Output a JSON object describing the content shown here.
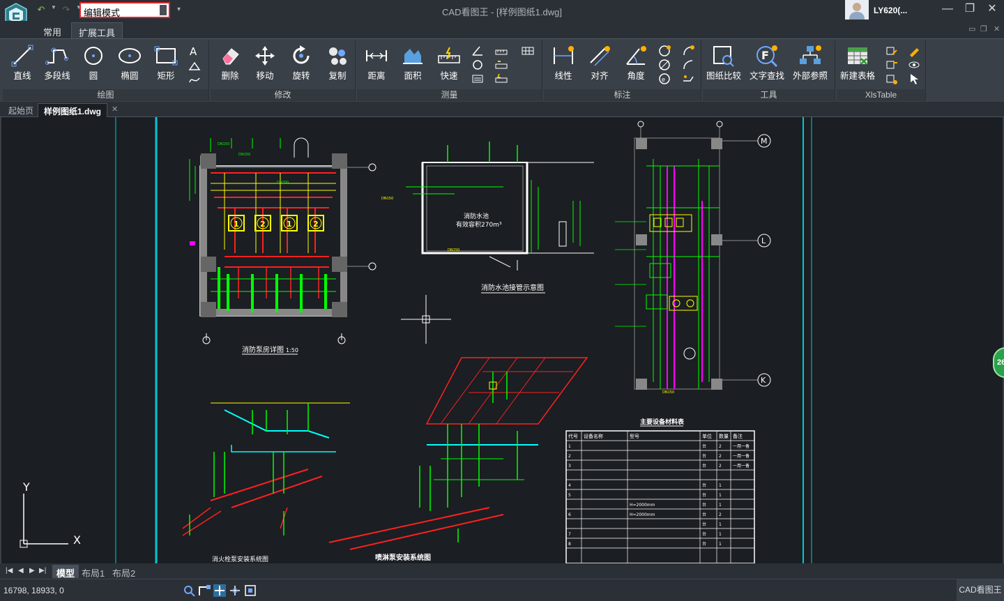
{
  "window": {
    "title": "CAD看图王 - [样例图纸1.dwg]",
    "mode": "编辑模式",
    "user": "LY620(...",
    "controls": {
      "minimize": "—",
      "restore": "❐",
      "close": "✕"
    }
  },
  "ribbon_tabs": [
    "常用",
    "扩展工具"
  ],
  "ribbon": {
    "groups": [
      {
        "label": "绘图",
        "tools": [
          "直线",
          "多段线",
          "圆",
          "椭圆",
          "矩形"
        ]
      },
      {
        "label": "修改",
        "tools": [
          "删除",
          "移动",
          "旋转",
          "复制"
        ]
      },
      {
        "label": "测量",
        "tools": [
          "距离",
          "面积",
          "快速"
        ]
      },
      {
        "label": "标注",
        "tools": [
          "线性",
          "对齐",
          "角度"
        ]
      },
      {
        "label": "工具",
        "tools": [
          "图纸比较",
          "文字查找",
          "外部参照"
        ]
      },
      {
        "label": "XlsTable",
        "tools": [
          "新建表格"
        ]
      }
    ]
  },
  "doc_tabs": [
    "起始页",
    "样例图纸1.dwg"
  ],
  "drawing": {
    "titles": {
      "pump_room": "消防泵房详图",
      "pump_room_scale": "1:50",
      "pool": "消防水池接管示意图",
      "pool_name": "消防水池",
      "pool_capacity": "有效容积270m³",
      "hydrant_system": "消火栓泵安装系统图",
      "sprinkler_system": "喷淋泵安装系统图",
      "table_title": "主要设备材料表"
    },
    "pump_labels": [
      "1",
      "2",
      "1",
      "2"
    ],
    "axis_labels": [
      "M",
      "L",
      "K"
    ],
    "table": {
      "headers": [
        "代号",
        "设备名称",
        "型号",
        "单位",
        "数量",
        "备注"
      ],
      "rows": [
        [
          "1",
          "",
          "",
          "台",
          "2",
          "一用一备"
        ],
        [
          "2",
          "",
          "",
          "台",
          "2",
          "一用一备"
        ],
        [
          "3",
          "",
          "",
          "台",
          "2",
          "一用一备"
        ],
        [
          "",
          "",
          "",
          "",
          "",
          ""
        ],
        [
          "4",
          "",
          "",
          "台",
          "1",
          ""
        ],
        [
          "5",
          "",
          "",
          "台",
          "1",
          ""
        ],
        [
          "",
          "",
          "H=2000mm",
          "台",
          "1",
          ""
        ],
        [
          "6",
          "",
          "H=2000mm",
          "台",
          "2",
          ""
        ],
        [
          "",
          "",
          "",
          "台",
          "1",
          ""
        ],
        [
          "7",
          "",
          "",
          "台",
          "1",
          ""
        ],
        [
          "8",
          "",
          "",
          "台",
          "1",
          ""
        ]
      ]
    },
    "ucs": {
      "x": "X",
      "y": "Y"
    }
  },
  "layout_tabs": [
    "模型",
    "布局1",
    "布局2"
  ],
  "status": {
    "coords": "16798, 18933, 0",
    "app_name": "CAD看图王"
  },
  "side_badge": "26",
  "colors": {
    "canvas_bg": "#1b1e22",
    "frame_cyan": "#00c8d8",
    "pipe_green": "#00ff00",
    "pipe_red": "#ff2020",
    "pipe_magenta": "#ff00ff",
    "pipe_yellow": "#ffff00",
    "line_white": "#ffffff",
    "accent_red": "#e0262b"
  }
}
